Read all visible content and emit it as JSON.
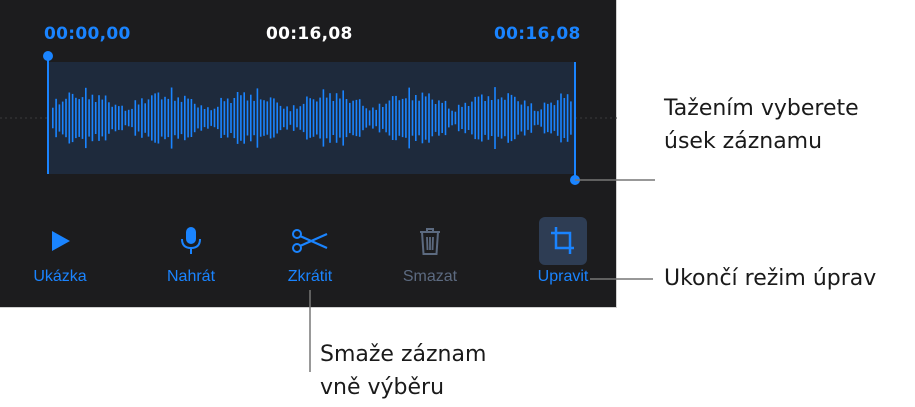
{
  "editor": {
    "start_time": "00:00,00",
    "current_time": "00:16,08",
    "end_time": "00:16,08"
  },
  "toolbar": {
    "buttons": [
      {
        "label": "Ukázka",
        "icon": "play-icon",
        "enabled": true
      },
      {
        "label": "Nahrát",
        "icon": "microphone-icon",
        "enabled": true
      },
      {
        "label": "Zkrátit",
        "icon": "scissors-icon",
        "enabled": true
      },
      {
        "label": "Smazat",
        "icon": "trash-icon",
        "enabled": false
      },
      {
        "label": "Upravit",
        "icon": "crop-icon",
        "enabled": true,
        "selected": true
      }
    ]
  },
  "callouts": {
    "selection_line1": "Tažením vyberete",
    "selection_line2": "úsek záznamu",
    "edit_mode": "Ukončí režim úprav",
    "trim_line1": "Smaže záznam",
    "trim_line2": "vně výběru"
  },
  "colors": {
    "panel_bg": "#1c1c1e",
    "accent": "#1a84ff",
    "selection_bg": "#1e2a3c",
    "disabled": "#5c6a80",
    "time_white": "#ffffff",
    "selected_button_bg": "#2e3d54"
  }
}
